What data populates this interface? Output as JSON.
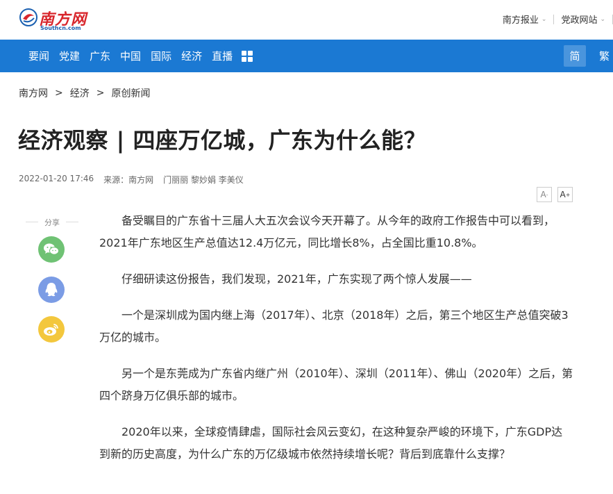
{
  "header": {
    "logo_cn": "南方网",
    "logo_en": "Southcn.com",
    "links": [
      "南方报业",
      "党政网站"
    ]
  },
  "nav": {
    "items": [
      "要闻",
      "党建",
      "广东",
      "中国",
      "国际",
      "经济",
      "直播"
    ],
    "lang_simplified": "简",
    "lang_traditional": "繁"
  },
  "breadcrumb": [
    "南方网",
    "经济",
    "原创新闻"
  ],
  "breadcrumb_sep": ">",
  "article": {
    "title": "经济观察 | 四座万亿城，广东为什么能？",
    "datetime": "2022-01-20 17:46",
    "source": "来源：南方网",
    "authors": "门丽丽 黎妙娟 李美仪",
    "paragraphs": [
      "备受瞩目的广东省十三届人大五次会议今天开幕了。从今年的政府工作报告中可以看到，2021年广东地区生产总值达12.4万亿元，同比增长8%，占全国比重10.8%。",
      "仔细研读这份报告，我们发现，2021年，广东实现了两个惊人发展——",
      "一个是深圳成为国内继上海（2017年）、北京（2018年）之后，第三个地区生产总值突破3万亿的城市。",
      "另一个是东莞成为广东省内继广州（2010年）、深圳（2011年）、佛山（2020年）之后，第四个跻身万亿俱乐部的城市。",
      "2020年以来，全球疫情肆虐，国际社会风云变幻，在这种复杂严峻的环境下，广东GDP达到新的历史高度，为什么广东的万亿级城市依然持续增长呢？背后到底靠什么支撑？"
    ]
  },
  "font_size": {
    "decrease": "A",
    "increase": "A",
    "decrease_mark": "-",
    "increase_mark": "+"
  },
  "share": {
    "label": "分享",
    "icons": [
      "wechat-icon",
      "qq-icon",
      "weibo-icon"
    ]
  },
  "colors": {
    "nav_bg": "#1b79d3",
    "logo_red": "#d8262c",
    "wechat": "#6fc274",
    "qq": "#7b9ce5",
    "weibo": "#f3c73d"
  }
}
